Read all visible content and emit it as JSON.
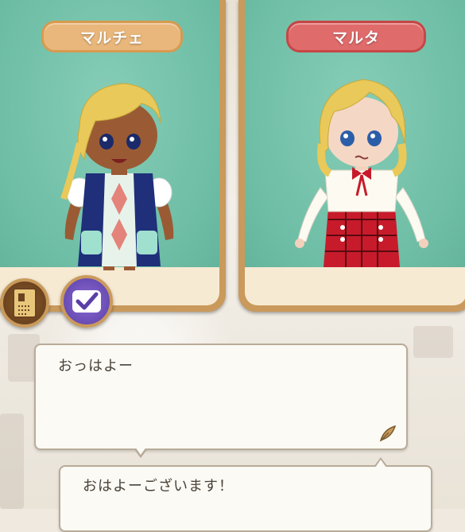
{
  "speakers": {
    "left": {
      "name": "マルチェ",
      "plate_color": "#e9b77b"
    },
    "right": {
      "name": "マルタ",
      "plate_color": "#e06b6b"
    }
  },
  "buttons": {
    "book": {
      "icon": "book-icon"
    },
    "check": {
      "icon": "check-icon"
    }
  },
  "dialogue": {
    "line1": "おっはよー",
    "line2": "おはよーございます！"
  },
  "colors": {
    "panel_frame": "#c99a5b",
    "stage": "#6fbea6",
    "bubble_bg": "#fbfaf5"
  }
}
